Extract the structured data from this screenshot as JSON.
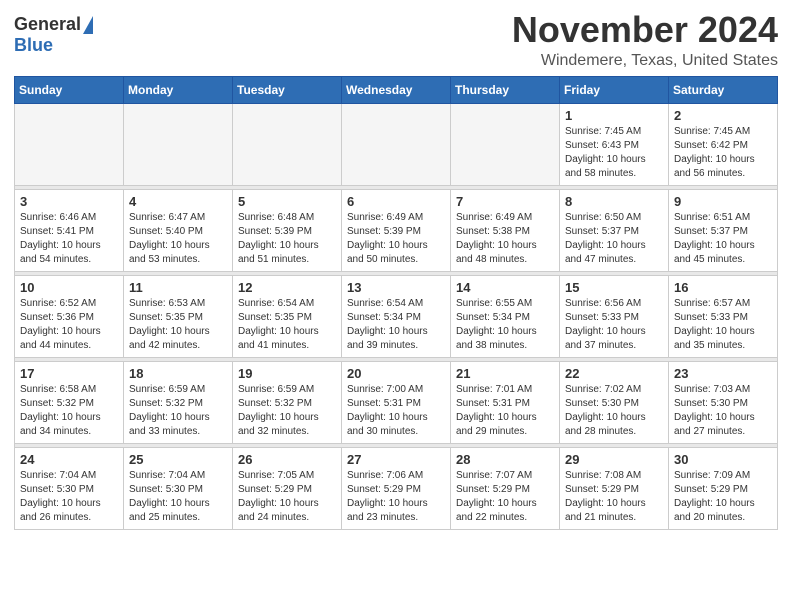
{
  "header": {
    "logo_general": "General",
    "logo_blue": "Blue",
    "month": "November 2024",
    "location": "Windemere, Texas, United States"
  },
  "days_of_week": [
    "Sunday",
    "Monday",
    "Tuesday",
    "Wednesday",
    "Thursday",
    "Friday",
    "Saturday"
  ],
  "weeks": [
    [
      {
        "day": "",
        "empty": true
      },
      {
        "day": "",
        "empty": true
      },
      {
        "day": "",
        "empty": true
      },
      {
        "day": "",
        "empty": true
      },
      {
        "day": "",
        "empty": true
      },
      {
        "day": "1",
        "sunrise": "Sunrise: 7:45 AM",
        "sunset": "Sunset: 6:43 PM",
        "daylight": "Daylight: 10 hours and 58 minutes."
      },
      {
        "day": "2",
        "sunrise": "Sunrise: 7:45 AM",
        "sunset": "Sunset: 6:42 PM",
        "daylight": "Daylight: 10 hours and 56 minutes."
      }
    ],
    [
      {
        "day": "3",
        "sunrise": "Sunrise: 6:46 AM",
        "sunset": "Sunset: 5:41 PM",
        "daylight": "Daylight: 10 hours and 54 minutes."
      },
      {
        "day": "4",
        "sunrise": "Sunrise: 6:47 AM",
        "sunset": "Sunset: 5:40 PM",
        "daylight": "Daylight: 10 hours and 53 minutes."
      },
      {
        "day": "5",
        "sunrise": "Sunrise: 6:48 AM",
        "sunset": "Sunset: 5:39 PM",
        "daylight": "Daylight: 10 hours and 51 minutes."
      },
      {
        "day": "6",
        "sunrise": "Sunrise: 6:49 AM",
        "sunset": "Sunset: 5:39 PM",
        "daylight": "Daylight: 10 hours and 50 minutes."
      },
      {
        "day": "7",
        "sunrise": "Sunrise: 6:49 AM",
        "sunset": "Sunset: 5:38 PM",
        "daylight": "Daylight: 10 hours and 48 minutes."
      },
      {
        "day": "8",
        "sunrise": "Sunrise: 6:50 AM",
        "sunset": "Sunset: 5:37 PM",
        "daylight": "Daylight: 10 hours and 47 minutes."
      },
      {
        "day": "9",
        "sunrise": "Sunrise: 6:51 AM",
        "sunset": "Sunset: 5:37 PM",
        "daylight": "Daylight: 10 hours and 45 minutes."
      }
    ],
    [
      {
        "day": "10",
        "sunrise": "Sunrise: 6:52 AM",
        "sunset": "Sunset: 5:36 PM",
        "daylight": "Daylight: 10 hours and 44 minutes."
      },
      {
        "day": "11",
        "sunrise": "Sunrise: 6:53 AM",
        "sunset": "Sunset: 5:35 PM",
        "daylight": "Daylight: 10 hours and 42 minutes."
      },
      {
        "day": "12",
        "sunrise": "Sunrise: 6:54 AM",
        "sunset": "Sunset: 5:35 PM",
        "daylight": "Daylight: 10 hours and 41 minutes."
      },
      {
        "day": "13",
        "sunrise": "Sunrise: 6:54 AM",
        "sunset": "Sunset: 5:34 PM",
        "daylight": "Daylight: 10 hours and 39 minutes."
      },
      {
        "day": "14",
        "sunrise": "Sunrise: 6:55 AM",
        "sunset": "Sunset: 5:34 PM",
        "daylight": "Daylight: 10 hours and 38 minutes."
      },
      {
        "day": "15",
        "sunrise": "Sunrise: 6:56 AM",
        "sunset": "Sunset: 5:33 PM",
        "daylight": "Daylight: 10 hours and 37 minutes."
      },
      {
        "day": "16",
        "sunrise": "Sunrise: 6:57 AM",
        "sunset": "Sunset: 5:33 PM",
        "daylight": "Daylight: 10 hours and 35 minutes."
      }
    ],
    [
      {
        "day": "17",
        "sunrise": "Sunrise: 6:58 AM",
        "sunset": "Sunset: 5:32 PM",
        "daylight": "Daylight: 10 hours and 34 minutes."
      },
      {
        "day": "18",
        "sunrise": "Sunrise: 6:59 AM",
        "sunset": "Sunset: 5:32 PM",
        "daylight": "Daylight: 10 hours and 33 minutes."
      },
      {
        "day": "19",
        "sunrise": "Sunrise: 6:59 AM",
        "sunset": "Sunset: 5:32 PM",
        "daylight": "Daylight: 10 hours and 32 minutes."
      },
      {
        "day": "20",
        "sunrise": "Sunrise: 7:00 AM",
        "sunset": "Sunset: 5:31 PM",
        "daylight": "Daylight: 10 hours and 30 minutes."
      },
      {
        "day": "21",
        "sunrise": "Sunrise: 7:01 AM",
        "sunset": "Sunset: 5:31 PM",
        "daylight": "Daylight: 10 hours and 29 minutes."
      },
      {
        "day": "22",
        "sunrise": "Sunrise: 7:02 AM",
        "sunset": "Sunset: 5:30 PM",
        "daylight": "Daylight: 10 hours and 28 minutes."
      },
      {
        "day": "23",
        "sunrise": "Sunrise: 7:03 AM",
        "sunset": "Sunset: 5:30 PM",
        "daylight": "Daylight: 10 hours and 27 minutes."
      }
    ],
    [
      {
        "day": "24",
        "sunrise": "Sunrise: 7:04 AM",
        "sunset": "Sunset: 5:30 PM",
        "daylight": "Daylight: 10 hours and 26 minutes."
      },
      {
        "day": "25",
        "sunrise": "Sunrise: 7:04 AM",
        "sunset": "Sunset: 5:30 PM",
        "daylight": "Daylight: 10 hours and 25 minutes."
      },
      {
        "day": "26",
        "sunrise": "Sunrise: 7:05 AM",
        "sunset": "Sunset: 5:29 PM",
        "daylight": "Daylight: 10 hours and 24 minutes."
      },
      {
        "day": "27",
        "sunrise": "Sunrise: 7:06 AM",
        "sunset": "Sunset: 5:29 PM",
        "daylight": "Daylight: 10 hours and 23 minutes."
      },
      {
        "day": "28",
        "sunrise": "Sunrise: 7:07 AM",
        "sunset": "Sunset: 5:29 PM",
        "daylight": "Daylight: 10 hours and 22 minutes."
      },
      {
        "day": "29",
        "sunrise": "Sunrise: 7:08 AM",
        "sunset": "Sunset: 5:29 PM",
        "daylight": "Daylight: 10 hours and 21 minutes."
      },
      {
        "day": "30",
        "sunrise": "Sunrise: 7:09 AM",
        "sunset": "Sunset: 5:29 PM",
        "daylight": "Daylight: 10 hours and 20 minutes."
      }
    ]
  ]
}
